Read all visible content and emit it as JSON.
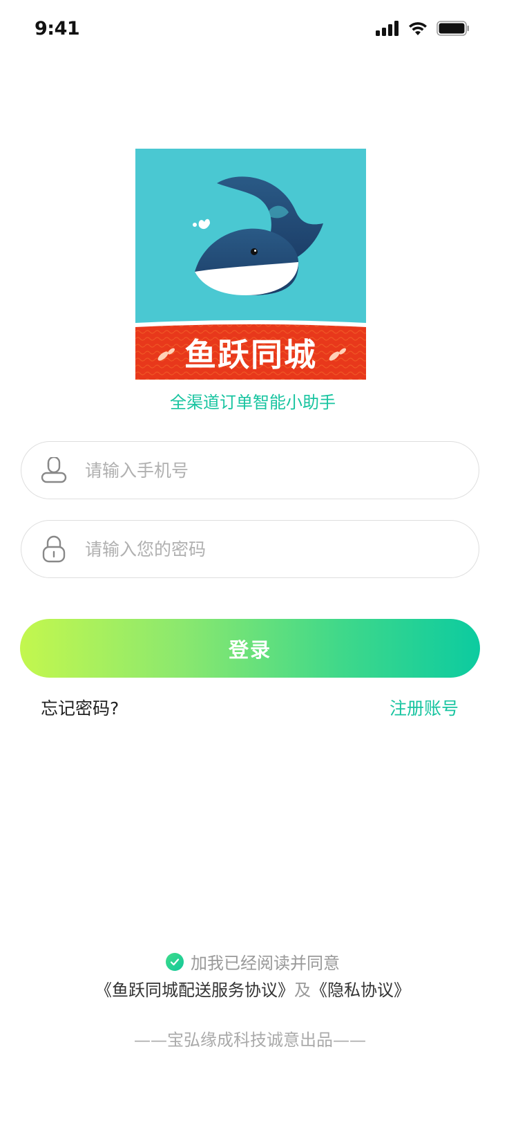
{
  "status_bar": {
    "time": "9:41"
  },
  "brand": {
    "logo_text": "鱼跃同城",
    "tagline": "全渠道订单智能小助手"
  },
  "form": {
    "phone_placeholder": "请输入手机号",
    "password_placeholder": "请输入您的密码",
    "login_label": "登录",
    "forgot_label": "忘记密码?",
    "register_label": "注册账号"
  },
  "agreement": {
    "checked": true,
    "prefix": "加我已经阅读并同意",
    "service_link": "《鱼跃同城配送服务协议》",
    "joiner": "及",
    "privacy_link": "《隐私协议》"
  },
  "footer": {
    "credit": "——宝弘缘成科技诚意出品——"
  },
  "colors": {
    "accent": "#18c4a0",
    "gradient_start": "#c3f74e",
    "gradient_end": "#0ccba0",
    "logo_bg": "#4ac8d2",
    "logo_banner": "#e8381b"
  },
  "icons": [
    "cellular-signal-icon",
    "wifi-icon",
    "battery-icon",
    "user-icon",
    "lock-icon",
    "check-circle-icon",
    "whale-logo"
  ]
}
